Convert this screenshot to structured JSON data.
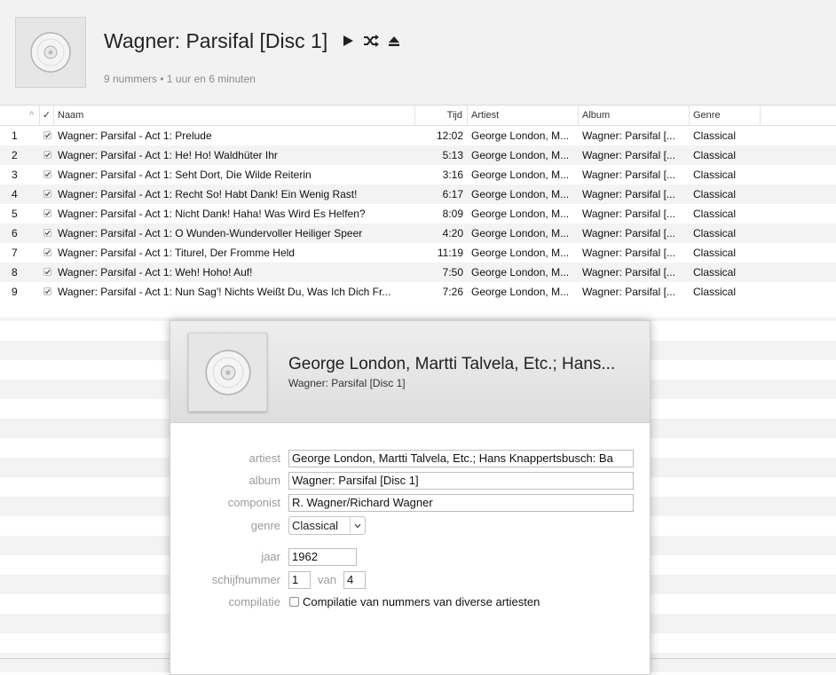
{
  "header": {
    "album_title": "Wagner: Parsifal [Disc 1]",
    "meta": "9 nummers • 1 uur en 6 minuten",
    "artwork_icon": "cd-icon",
    "controls": [
      "play-icon",
      "shuffle-icon",
      "eject-icon"
    ]
  },
  "table": {
    "columns": {
      "sort_indicator": "^",
      "check": "✓",
      "name": "Naam",
      "time": "Tijd",
      "artist": "Artiest",
      "album": "Album",
      "genre": "Genre"
    },
    "rows": [
      {
        "num": "1",
        "name": "Wagner: Parsifal - Act 1: Prelude",
        "time": "12:02",
        "artist": "George London, M...",
        "album": "Wagner: Parsifal [...",
        "genre": "Classical"
      },
      {
        "num": "2",
        "name": "Wagner: Parsifal - Act 1: He! Ho! Waldhüter Ihr",
        "time": "5:13",
        "artist": "George London, M...",
        "album": "Wagner: Parsifal [...",
        "genre": "Classical"
      },
      {
        "num": "3",
        "name": "Wagner: Parsifal - Act 1: Seht Dort, Die Wilde Reiterin",
        "time": "3:16",
        "artist": "George London, M...",
        "album": "Wagner: Parsifal [...",
        "genre": "Classical"
      },
      {
        "num": "4",
        "name": "Wagner: Parsifal - Act 1: Recht So! Habt Dank! Ein Wenig Rast!",
        "time": "6:17",
        "artist": "George London, M...",
        "album": "Wagner: Parsifal [...",
        "genre": "Classical"
      },
      {
        "num": "5",
        "name": "Wagner: Parsifal - Act 1: Nicht Dank! Haha! Was Wird Es Helfen?",
        "time": "8:09",
        "artist": "George London, M...",
        "album": "Wagner: Parsifal [...",
        "genre": "Classical"
      },
      {
        "num": "6",
        "name": "Wagner: Parsifal - Act 1: O Wunden-Wundervoller Heiliger Speer",
        "time": "4:20",
        "artist": "George London, M...",
        "album": "Wagner: Parsifal [...",
        "genre": "Classical"
      },
      {
        "num": "7",
        "name": "Wagner: Parsifal - Act 1: Titurel, Der Fromme Held",
        "time": "11:19",
        "artist": "George London, M...",
        "album": "Wagner: Parsifal [...",
        "genre": "Classical"
      },
      {
        "num": "8",
        "name": "Wagner: Parsifal - Act 1: Weh! Hoho! Auf!",
        "time": "7:50",
        "artist": "George London, M...",
        "album": "Wagner: Parsifal [...",
        "genre": "Classical"
      },
      {
        "num": "9",
        "name": "Wagner: Parsifal - Act 1: Nun Sag'! Nichts Weißt Du, Was Ich Dich Fr...",
        "time": "7:26",
        "artist": "George London, M...",
        "album": "Wagner: Parsifal [...",
        "genre": "Classical"
      }
    ]
  },
  "dialog": {
    "title_artist": "George London, Martti Talvela, Etc.; Hans...",
    "title_album": "Wagner: Parsifal [Disc 1]",
    "labels": {
      "artist": "artiest",
      "album": "album",
      "composer": "componist",
      "genre": "genre",
      "year": "jaar",
      "disc_number": "schijfnummer",
      "of": "van",
      "compilation": "compilatie"
    },
    "values": {
      "artist": "George London, Martti Talvela, Etc.; Hans Knappertsbusch: Ba",
      "album": "Wagner: Parsifal [Disc 1]",
      "composer": "R. Wagner/Richard Wagner",
      "genre": "Classical",
      "year": "1962",
      "disc_number": "1",
      "disc_total": "4"
    },
    "compilation_label": "Compilatie van nummers van diverse artiesten",
    "compilation_checked": false
  }
}
